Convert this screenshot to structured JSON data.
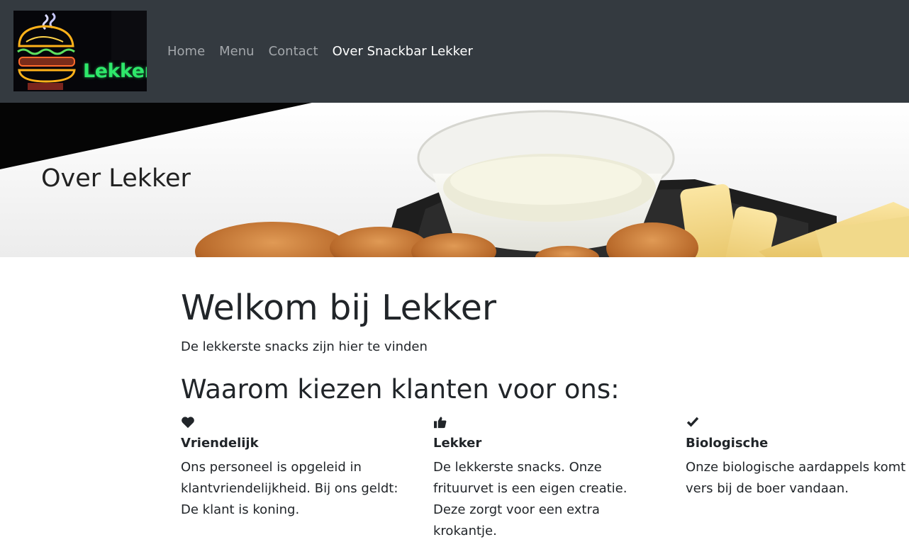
{
  "navbar": {
    "logo_text": "Lekker",
    "links": [
      {
        "label": "Home",
        "active": false
      },
      {
        "label": "Menu",
        "active": false
      },
      {
        "label": "Contact",
        "active": false
      },
      {
        "label": "Over Snackbar Lekker",
        "active": true
      }
    ],
    "background": "#343a40"
  },
  "hero": {
    "title": "Over Lekker"
  },
  "main": {
    "title": "Welkom bij Lekker",
    "subtitle": "De lekkerste snacks zijn hier te vinden",
    "why_title": "Waarom kiezen klanten voor ons:",
    "features": [
      {
        "icon": "heart-icon",
        "title": "Vriendelijk",
        "text": "Ons personeel is opgeleid in klantvriendelijkheid. Bij ons geldt: De klant is koning."
      },
      {
        "icon": "thumbs-up-icon",
        "title": "Lekker",
        "text": "De lekkerste snacks. Onze frituurvet is een eigen creatie. Deze zorgt voor een extra krokantje."
      },
      {
        "icon": "check-icon",
        "title": "Biologische",
        "text": "Onze biologische aardappels komt vers bij de boer vandaan."
      }
    ]
  }
}
